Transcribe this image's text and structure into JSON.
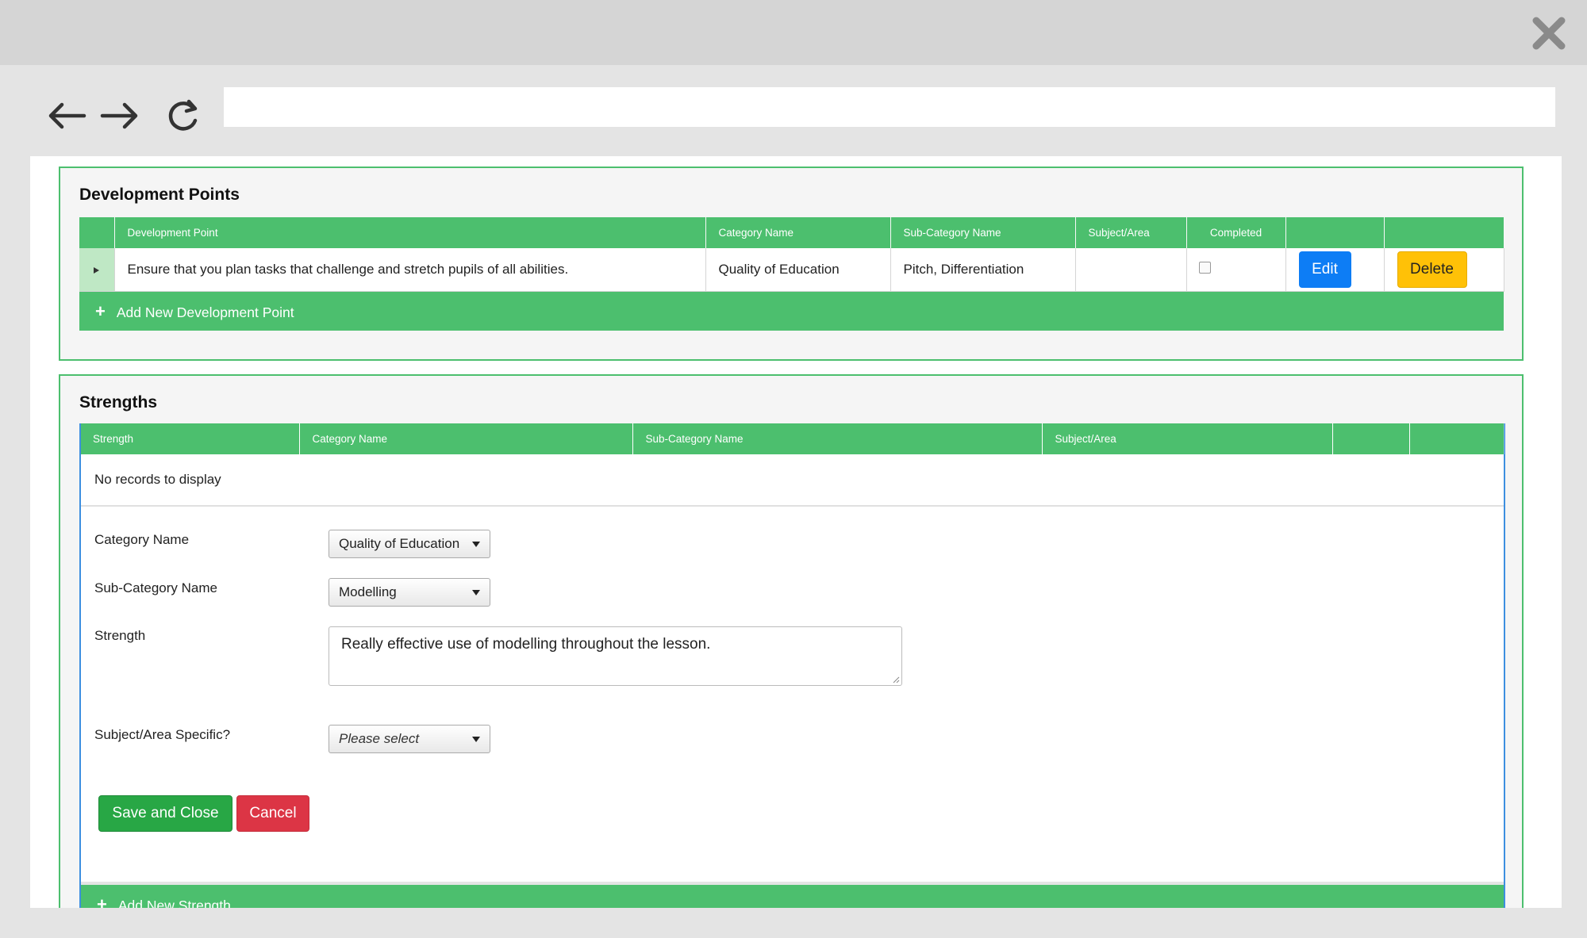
{
  "browser": {
    "url": "",
    "icons": [
      "back-arrow-icon",
      "forward-arrow-icon",
      "reload-icon",
      "close-icon"
    ]
  },
  "development_points": {
    "title": "Development Points",
    "columns": [
      "Development Point",
      "Category Name",
      "Sub-Category Name",
      "Subject/Area",
      "Completed",
      "",
      ""
    ],
    "rows": [
      {
        "development_point": "Ensure that you plan tasks that challenge and stretch pupils of all abilities.",
        "category": "Quality of Education",
        "sub_category": "Pitch, Differentiation",
        "subject_area": "",
        "completed": false,
        "edit_label": "Edit",
        "delete_label": "Delete"
      }
    ],
    "add_label": "Add New Development Point"
  },
  "strengths": {
    "title": "Strengths",
    "columns": [
      "Strength",
      "Category Name",
      "Sub-Category Name",
      "Subject/Area",
      "",
      ""
    ],
    "no_records": "No records to display",
    "form": {
      "category_label": "Category Name",
      "category_value": "Quality of Education",
      "subcategory_label": "Sub-Category Name",
      "subcategory_value": "Modelling",
      "strength_label": "Strength",
      "strength_value": "Really effective use of modelling throughout the lesson.",
      "subject_label": "Subject/Area Specific?",
      "subject_placeholder": "Please select",
      "save_label": "Save and Close",
      "cancel_label": "Cancel"
    },
    "add_label": "Add New Strength"
  },
  "colors": {
    "grid_header": "#4cbf6e",
    "panel_border": "#4cbf6e",
    "edit": "#0d7df5",
    "delete": "#ffc107",
    "save": "#28a745",
    "cancel": "#dc3545"
  }
}
